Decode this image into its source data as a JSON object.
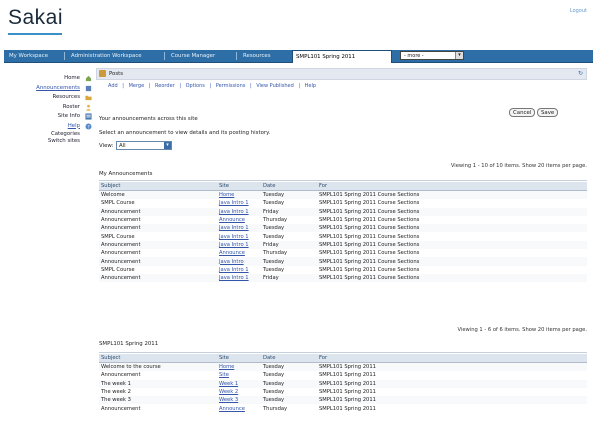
{
  "header": {
    "logo": "Sakai",
    "logout": "Logout"
  },
  "tabs": [
    {
      "label": "My Workspace",
      "active": false
    },
    {
      "label": "Administration Workspace",
      "active": false
    },
    {
      "label": "Course Manager",
      "active": false
    },
    {
      "label": "Resources",
      "active": false
    },
    {
      "label": "SMPL101 Spring 2011",
      "active": true
    }
  ],
  "site_select": {
    "value": "- more -"
  },
  "toolmenu": {
    "items": [
      {
        "label": "Home",
        "link": false,
        "icon_color": "#7aa653"
      },
      {
        "label": "Announcements",
        "link": true,
        "icon_color": "#5b7fb8"
      },
      {
        "label": "Resources",
        "link": false,
        "icon_color": "#d9a73a"
      },
      {
        "label": "Roster",
        "link": false,
        "icon_color": "#e0b84a"
      },
      {
        "label": "Site Info",
        "link": false,
        "icon_color": "#4a78b0"
      },
      {
        "label": "Help",
        "link": false,
        "icon_color": "#5588cc"
      }
    ],
    "footer": [
      "Categories",
      "Switch sites"
    ]
  },
  "tool": {
    "title": "Posts",
    "reset": "↻",
    "actions": [
      "Add",
      "|",
      "Merge",
      "|",
      "Reorder",
      "|",
      "Options",
      "|",
      "Permissions",
      "|",
      "View Published",
      "|",
      "Help"
    ],
    "notice": "Your announcements across this site",
    "hint": "Select an announcement to view details and its posting history.",
    "view_label": "View:",
    "view_value": "All",
    "buttons": [
      "Cancel",
      "Save"
    ]
  },
  "listing1": {
    "caption": "My Announcements",
    "pager": "Viewing 1 - 10 of 10 items. Show 20 items per page.",
    "headers": [
      "Subject",
      "Site",
      "Date",
      "For"
    ],
    "rows": [
      [
        "Welcome",
        "Home",
        "Tuesday",
        "SMPL101 Spring 2011 Course Sections"
      ],
      [
        "SMPL Course",
        "Java Intro 1",
        "Tuesday",
        "SMPL101 Spring 2011 Course Sections"
      ],
      [
        "Announcement",
        "Java Intro 1",
        "Friday",
        "SMPL101 Spring 2011 Course Sections"
      ],
      [
        "Announcement",
        "Announce",
        "Thursday",
        "SMPL101 Spring 2011 Course Sections"
      ],
      [
        "Announcement",
        "Java Intro 1",
        "Tuesday",
        "SMPL101 Spring 2011 Course Sections"
      ],
      [
        "SMPL Course",
        "Java Intro 1",
        "Tuesday",
        "SMPL101 Spring 2011 Course Sections"
      ],
      [
        "Announcement",
        "Java Intro 1",
        "Friday",
        "SMPL101 Spring 2011 Course Sections"
      ],
      [
        "Announcement",
        "Announce",
        "Thursday",
        "SMPL101 Spring 2011 Course Sections"
      ],
      [
        "Announcement",
        "Java Intro",
        "Tuesday",
        "SMPL101 Spring 2011 Course Sections"
      ],
      [
        "SMPL Course",
        "Java Intro 1",
        "Tuesday",
        "SMPL101 Spring 2011 Course Sections"
      ],
      [
        "Announcement",
        "Java Intro 1",
        "Friday",
        "SMPL101 Spring 2011 Course Sections"
      ]
    ]
  },
  "listing2": {
    "caption": "SMPL101 Spring 2011",
    "pager": "Viewing 1 - 6 of 6 items. Show 20 items per page.",
    "headers": [
      "Subject",
      "Site",
      "Date",
      "For"
    ],
    "rows": [
      [
        "Welcome to the course",
        "Home",
        "Tuesday",
        "SMPL101 Spring 2011"
      ],
      [
        "Announcement",
        "Site",
        "Tuesday",
        "SMPL101 Spring 2011"
      ],
      [
        "The week 1",
        "Week 1",
        "Tuesday",
        "SMPL101 Spring 2011"
      ],
      [
        "The week 2",
        "Week 2",
        "Tuesday",
        "SMPL101 Spring 2011"
      ],
      [
        "The week 3",
        "Week 3",
        "Tuesday",
        "SMPL101 Spring 2011"
      ],
      [
        "Announcement",
        "Announce",
        "Thursday",
        "SMPL101 Spring 2011"
      ]
    ]
  }
}
